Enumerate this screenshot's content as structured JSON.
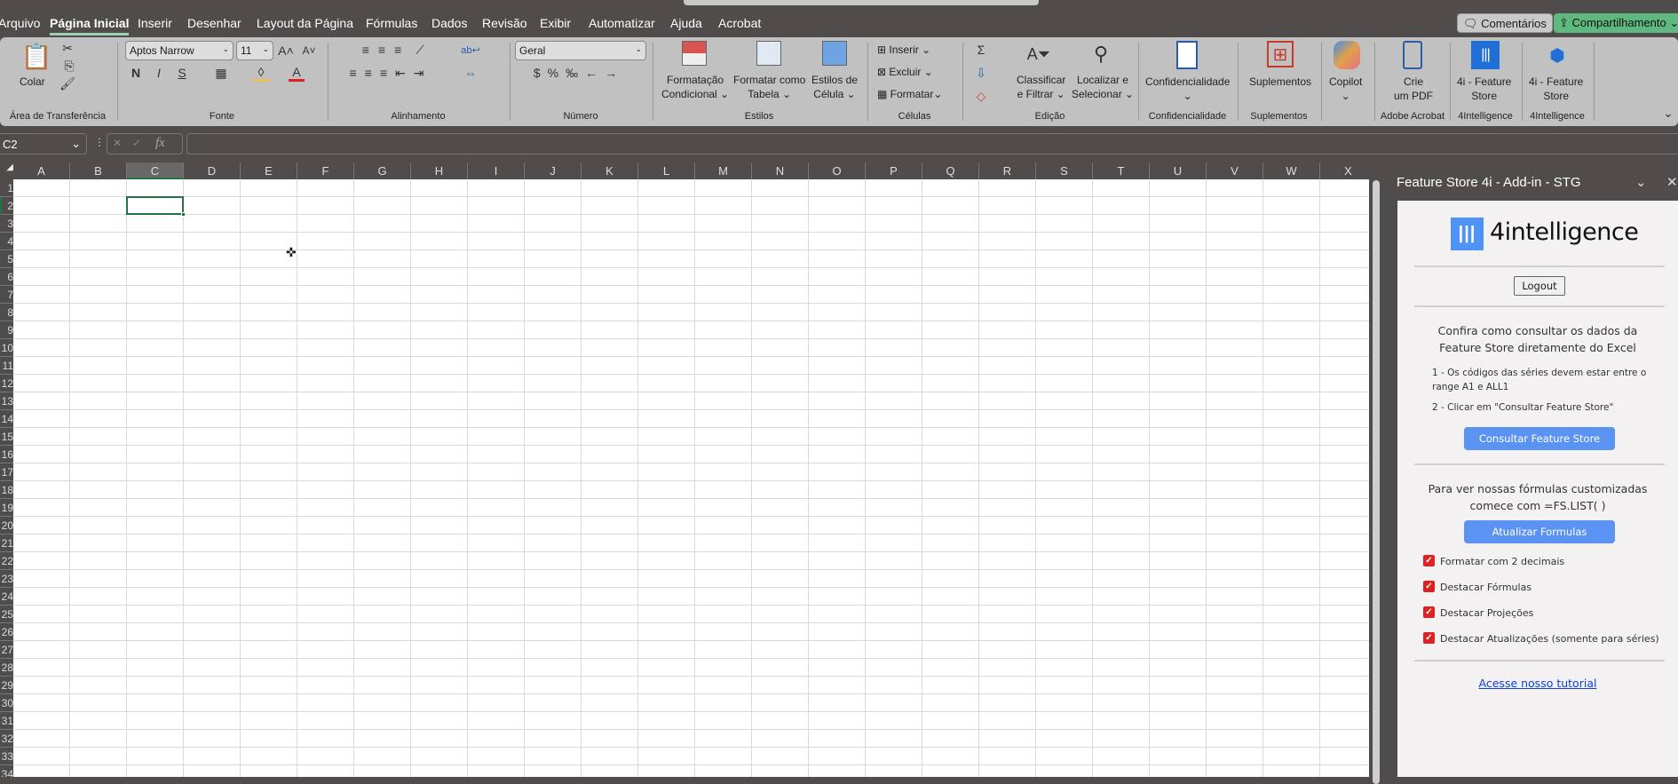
{
  "tabs": [
    "Arquivo",
    "Página Inicial",
    "Inserir",
    "Desenhar",
    "Layout da Página",
    "Fórmulas",
    "Dados",
    "Revisão",
    "Exibir",
    "Automatizar",
    "Ajuda",
    "Acrobat"
  ],
  "top_buttons": {
    "comments": "Comentários",
    "share": "Compartilhamento"
  },
  "ribbon": {
    "clipboard": {
      "paste": "Colar",
      "label": "Área de Transferência"
    },
    "font": {
      "name": "Aptos Narrow",
      "size": "11",
      "bold": "N",
      "italic": "I",
      "underline": "S",
      "label": "Fonte"
    },
    "alignment": {
      "label": "Alinhamento"
    },
    "number": {
      "format": "Geral",
      "label": "Número"
    },
    "styles": {
      "conditional": [
        "Formatação",
        "Condicional"
      ],
      "table": [
        "Formatar como",
        "Tabela"
      ],
      "cell": [
        "Estilos de",
        "Célula"
      ],
      "label": "Estilos"
    },
    "cells": {
      "insert": "Inserir",
      "delete": "Excluir",
      "format": "Formatar",
      "label": "Células"
    },
    "editing": {
      "sort": [
        "Classificar",
        "e Filtrar"
      ],
      "find": [
        "Localizar e",
        "Selecionar"
      ],
      "label": "Edição"
    },
    "confidentiality": {
      "button": "Confidencialidade",
      "label": "Confidencialidade"
    },
    "addins": {
      "button": "Suplementos",
      "label": "Suplementos"
    },
    "copilot": {
      "button": "Copilot"
    },
    "acrobat": {
      "button": [
        "Crie",
        "um PDF"
      ],
      "label": "Adobe Acrobat"
    },
    "fs1": {
      "button": [
        "4i - Feature",
        "Store"
      ],
      "label": "4Intelligence"
    },
    "fs2": {
      "button": [
        "4i - Feature",
        "Store"
      ],
      "label": "4Intelligence"
    }
  },
  "formula_bar": {
    "name_box": "C2",
    "fx": "fx",
    "value": ""
  },
  "grid": {
    "columns": [
      "A",
      "B",
      "C",
      "D",
      "E",
      "F",
      "G",
      "H",
      "I",
      "J",
      "K",
      "L",
      "M",
      "N",
      "O",
      "P",
      "Q",
      "R",
      "S",
      "T",
      "U",
      "V",
      "W",
      "X"
    ],
    "row_count": 34,
    "selected_cell": "C2"
  },
  "pane": {
    "title": "Feature Store 4i - Add-in - STG",
    "logo_text": "4intelligence",
    "logout": "Logout",
    "intro": [
      "Confira como consultar os dados da",
      "Feature Store diretamente do Excel"
    ],
    "step1": [
      "1 - Os códigos das séries devem estar entre o",
      "range A1 e ALL1"
    ],
    "step2": "2 - Clicar em \"Consultar Feature Store\"",
    "consult_button": "Consultar Feature Store",
    "formulas_text": [
      "Para ver nossas fórmulas customizadas",
      "comece com =FS.LIST( )"
    ],
    "update_button": "Atualizar Formulas",
    "options": [
      "Formatar com 2 decimais",
      "Destacar Fórmulas",
      "Destacar Projeções",
      "Destacar Atualizações (somente para séries)"
    ],
    "tutorial_link": "Acesse nosso tutorial"
  },
  "colors": {
    "accent": "#217346",
    "button": "#5b93f3",
    "checkbox": "#dd2222",
    "share": "#5fb97e"
  }
}
